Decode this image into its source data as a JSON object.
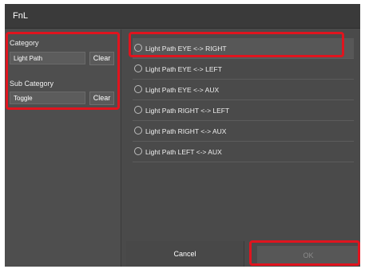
{
  "window": {
    "title": "FnL"
  },
  "left": {
    "category": {
      "label": "Category",
      "value": "Light Path",
      "clear": "Clear"
    },
    "sub_category": {
      "label": "Sub Category",
      "value": "Toggle",
      "clear": "Clear"
    }
  },
  "options": [
    {
      "label": "Light Path EYE <-> RIGHT",
      "selected": false
    },
    {
      "label": "Light Path EYE <-> LEFT",
      "selected": false
    },
    {
      "label": "Light Path EYE <-> AUX",
      "selected": false
    },
    {
      "label": "Light Path RIGHT <-> LEFT",
      "selected": false
    },
    {
      "label": "Light Path RIGHT <-> AUX",
      "selected": false
    },
    {
      "label": "Light Path LEFT <-> AUX",
      "selected": false
    }
  ],
  "buttons": {
    "cancel": "Cancel",
    "ok": "OK"
  },
  "colors": {
    "highlight": "#e0141e",
    "panel": "#4a4a4a",
    "titlebar": "#3a3a3a"
  }
}
